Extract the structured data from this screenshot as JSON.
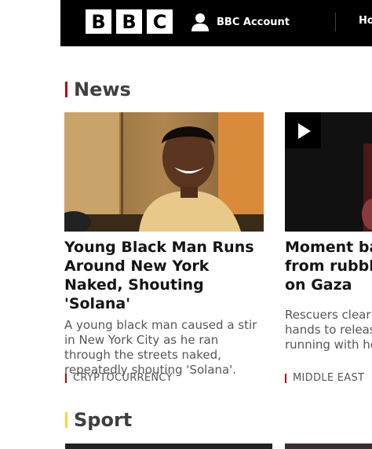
{
  "header": {
    "logo": [
      "B",
      "B",
      "C"
    ],
    "account_label": "BBC Account",
    "nav_home": "Ho"
  },
  "sections": {
    "news": {
      "title": "News",
      "accent": "#b80000"
    },
    "sport": {
      "title": "Sport",
      "accent": "#ffd230"
    }
  },
  "cards": [
    {
      "headline": "Young Black Man Runs Around New York Naked, Shouting 'Solana'",
      "summary": "A young black man caused a stir in New York City as he ran through the streets naked, repeatedly shouting 'Solana'.",
      "tag": "CRYPTOCURRENCY"
    },
    {
      "headline": "Moment bal from rubble on Gaza",
      "summary": "Rescuers clear hands to releas running with he",
      "tag": "MIDDLE EAST",
      "has_video": true
    }
  ]
}
